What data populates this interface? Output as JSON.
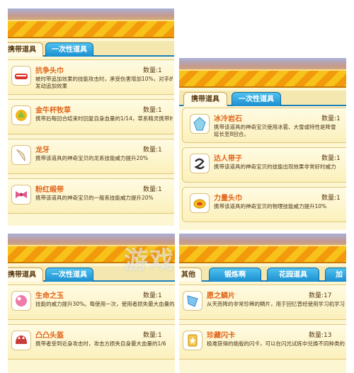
{
  "panel_a": {
    "tabs": [
      "携带道具",
      "一次性道具"
    ],
    "items": [
      {
        "name": "抗争头巾",
        "qty": "数量:1",
        "desc": [
          "被时带追加效果的技能攻击时，承受伤害增加10%，对手的",
          "发动追加效果"
        ],
        "icon": "bandana-icon"
      },
      {
        "name": "金牛杯牧草",
        "qty": "数量:1",
        "desc": [
          "携带后每回合结束时回复自身血量的1/14，草系精灵携带时"
        ],
        "icon": "trophy-grass-icon"
      },
      {
        "name": "龙牙",
        "qty": "数量:1",
        "desc": [
          "携带该道具的神奇宝贝的龙系技能威力提升20%"
        ],
        "icon": "dragon-fang-icon"
      },
      {
        "name": "粉红缎带",
        "qty": "数量:1",
        "desc": [
          "携带该道具的神奇宝贝的一般系技能威力提升20%"
        ],
        "icon": "pink-ribbon-icon"
      }
    ]
  },
  "panel_b": {
    "tabs": [
      "携带道具",
      "一次性道具"
    ],
    "items": [
      {
        "name": "冰冷岩石",
        "qty": "数量:1",
        "desc": [
          "携带该道具的神奇宝贝使用冰雹、大雪或特性是降雪",
          "延长至8回合。"
        ],
        "icon": "ice-rock-icon"
      },
      {
        "name": "达人带子",
        "qty": "数量:1",
        "desc": [
          "携带该道具的神奇宝贝的技能出现效果非常好时威力"
        ],
        "icon": "expert-belt-icon"
      },
      {
        "name": "力量头巾",
        "qty": "数量:1",
        "desc": [
          "携带该道具的神奇宝贝的物理技能威力提升10%"
        ],
        "icon": "muscle-band-icon"
      }
    ]
  },
  "panel_c": {
    "tabs": [
      "携带道具",
      "一次性道具"
    ],
    "items": [
      {
        "name": "生命之玉",
        "qty": "数量:1",
        "desc": [
          "技能的威力提升30%。每使用一次，使用者损失最大血量的1"
        ],
        "icon": "life-orb-icon"
      },
      {
        "name": "凸凸头盔",
        "qty": "数量:1",
        "desc": [
          "携带者受到近身攻击时，攻击方损失自身最大血量的1/6"
        ],
        "icon": "rocky-helmet-icon"
      }
    ]
  },
  "panel_d": {
    "tabs": [
      "其他",
      "锻炼啊",
      "花园道具",
      "加"
    ],
    "items": [
      {
        "name": "愿之鳞片",
        "qty": "数量:17",
        "desc": [
          "从天而降的非常珍稀的鳞片，用于回忆曾经使用学习机学习"
        ],
        "icon": "wish-scale-icon"
      },
      {
        "name": "珍藏闪卡",
        "qty": "数量:13",
        "desc": [
          "极难获得的绝版的闪卡，可以在闪光试练中兑换不同种类的"
        ],
        "icon": "shiny-card-icon"
      }
    ]
  },
  "watermark": "游戏"
}
